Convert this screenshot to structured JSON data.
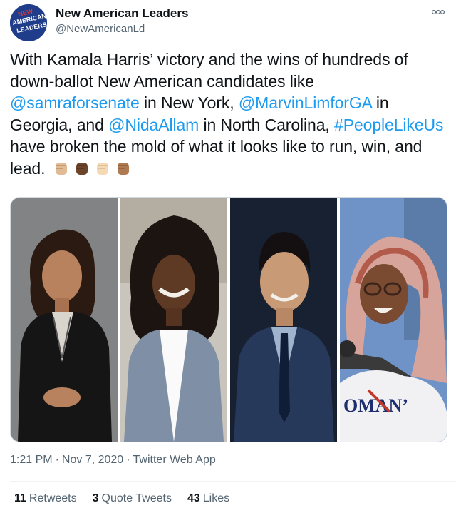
{
  "account": {
    "display_name": "New American Leaders",
    "handle": "@NewAmericanLd",
    "avatar_logo_text": [
      "NEW",
      "AMERICAN",
      "LEADERS"
    ],
    "avatar_color": "#1f3d8a"
  },
  "tweet": {
    "text_1": "With Kamala Harris’ victory and the wins of hundreds of down-ballot New American candidates like ",
    "mention_1": "@samraforsenate",
    "text_2": " in New York, ",
    "mention_2": "@MarvinLimforGA",
    "text_3": " in Georgia, and ",
    "mention_3": "@NidaAllam",
    "text_4": " in North Carolina, ",
    "hashtag": "#PeopleLikeUs",
    "text_5": " have broken the mold of what it looks like to run, win, and lead. ",
    "emojis": [
      "raised-fist-light-icon",
      "raised-fist-dark-icon",
      "raised-fist-pale-icon",
      "raised-fist-medium-icon"
    ],
    "link_color": "#1d9bf0"
  },
  "media": {
    "photos": [
      "photo-1",
      "photo-2",
      "photo-3",
      "photo-4"
    ]
  },
  "meta": {
    "time": "1:21 PM",
    "dot": "·",
    "date": "Nov 7, 2020",
    "source": "Twitter Web App"
  },
  "stats": {
    "retweets_count": "11",
    "retweets_label": "Retweets",
    "quotes_count": "3",
    "quotes_label": "Quote Tweets",
    "likes_count": "43",
    "likes_label": "Likes"
  }
}
